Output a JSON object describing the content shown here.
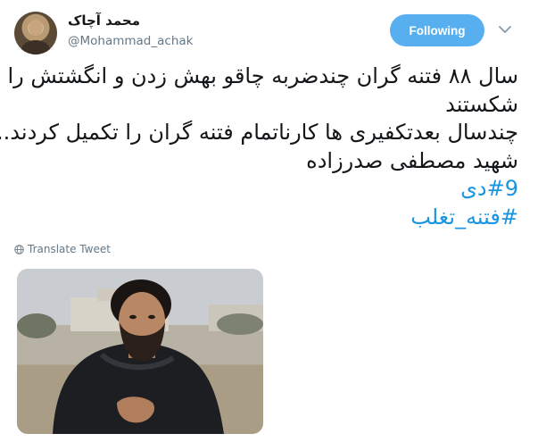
{
  "author": {
    "name": "محمد آچاک",
    "handle": "@Mohammad_achak"
  },
  "header": {
    "follow_label": "Following",
    "menu_icon": "chevron-down-icon"
  },
  "tweet": {
    "lines": [
      "سال ۸۸ فتنه گران چندضربه چاقو بهش زدن و انگشتش را",
      "شکستند",
      "چندسال بعدتکفیری ها کارناتمام فتنه گران را تکمیل کردند...",
      "شهید مصطفی صدرزاده"
    ],
    "hashtags": [
      "#9دی",
      "#فتنه_تغلب"
    ]
  },
  "translate": {
    "label": "Translate Tweet",
    "icon": "globe-icon"
  },
  "colors": {
    "follow_bg": "#58aff0",
    "hashtag": "#1b95e0",
    "meta": "#657786",
    "text": "#14171a"
  }
}
